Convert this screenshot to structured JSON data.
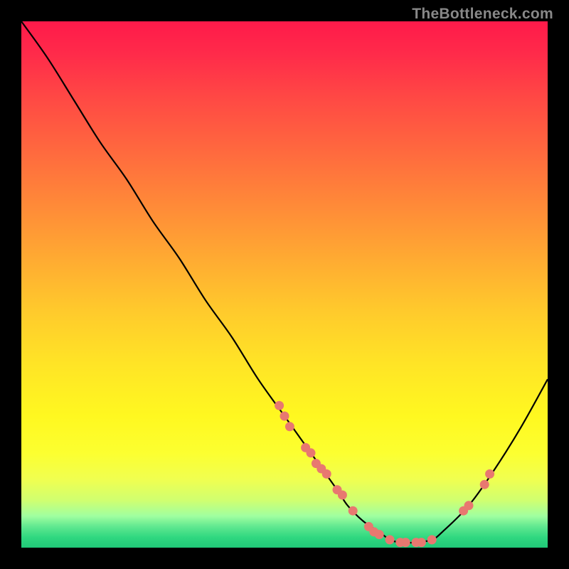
{
  "watermark": "TheBottleneck.com",
  "chart_data": {
    "type": "line",
    "title": "",
    "xlabel": "",
    "ylabel": "",
    "xlim": [
      0,
      100
    ],
    "ylim": [
      0,
      100
    ],
    "series": [
      {
        "name": "bottleneck-curve",
        "x": [
          0,
          5,
          10,
          15,
          20,
          25,
          30,
          35,
          40,
          45,
          50,
          55,
          60,
          62,
          65,
          68,
          70,
          72,
          75,
          78,
          80,
          85,
          90,
          95,
          100
        ],
        "y": [
          100,
          93,
          85,
          77,
          70,
          62,
          55,
          47,
          40,
          32,
          25,
          18,
          11,
          8,
          5,
          3,
          1.5,
          1,
          1,
          1.5,
          3,
          8,
          15,
          23,
          32
        ]
      }
    ],
    "markers": {
      "name": "highlighted-points",
      "color": "#e87870",
      "points": [
        {
          "x": 49,
          "y": 27
        },
        {
          "x": 50,
          "y": 25
        },
        {
          "x": 51,
          "y": 23
        },
        {
          "x": 54,
          "y": 19
        },
        {
          "x": 55,
          "y": 18
        },
        {
          "x": 56,
          "y": 16
        },
        {
          "x": 57,
          "y": 15
        },
        {
          "x": 58,
          "y": 14
        },
        {
          "x": 60,
          "y": 11
        },
        {
          "x": 61,
          "y": 10
        },
        {
          "x": 63,
          "y": 7
        },
        {
          "x": 66,
          "y": 4
        },
        {
          "x": 67,
          "y": 3
        },
        {
          "x": 68,
          "y": 2.5
        },
        {
          "x": 70,
          "y": 1.5
        },
        {
          "x": 72,
          "y": 1
        },
        {
          "x": 73,
          "y": 1
        },
        {
          "x": 75,
          "y": 1
        },
        {
          "x": 76,
          "y": 1
        },
        {
          "x": 78,
          "y": 1.5
        },
        {
          "x": 84,
          "y": 7
        },
        {
          "x": 85,
          "y": 8
        },
        {
          "x": 88,
          "y": 12
        },
        {
          "x": 89,
          "y": 14
        }
      ]
    }
  }
}
